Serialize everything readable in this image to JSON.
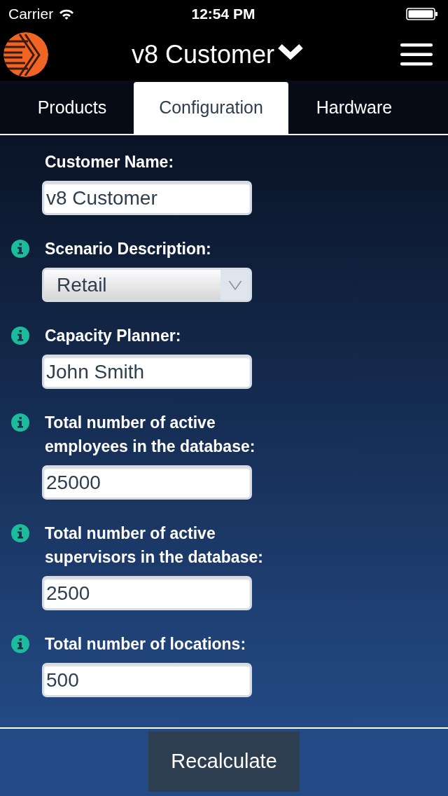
{
  "status_bar": {
    "carrier": "Carrier",
    "time": "12:54 PM"
  },
  "header": {
    "title": "v8 Customer"
  },
  "tabs": [
    {
      "label": "Products",
      "selected": false
    },
    {
      "label": "Configuration",
      "selected": true
    },
    {
      "label": "Hardware",
      "selected": false
    }
  ],
  "fields": [
    {
      "kind": "text",
      "label": "Customer Name:",
      "info": false,
      "value": "v8 Customer"
    },
    {
      "kind": "select",
      "label": "Scenario Description:",
      "info": true,
      "value": "Retail"
    },
    {
      "kind": "text",
      "label": "Capacity Planner:",
      "info": true,
      "value": "John Smith"
    },
    {
      "kind": "text",
      "label": "Total number of active employees in the database:",
      "info": true,
      "value": "25000"
    },
    {
      "kind": "text",
      "label": "Total number of active supervisors in the database:",
      "info": true,
      "value": "2500"
    },
    {
      "kind": "text",
      "label": "Total number of locations:",
      "info": true,
      "value": "500"
    }
  ],
  "footer": {
    "button": "Recalculate"
  }
}
